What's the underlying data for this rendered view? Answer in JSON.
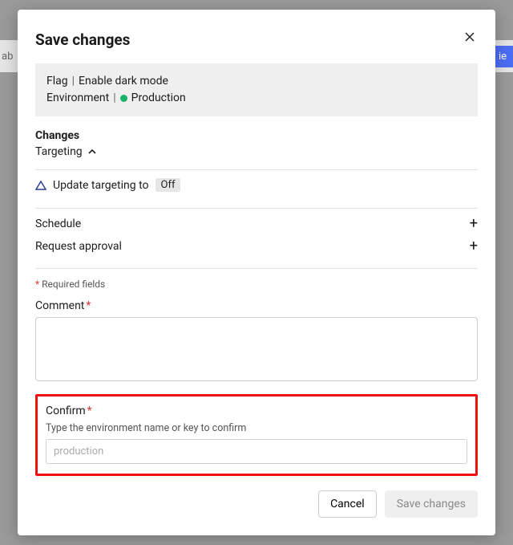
{
  "modal": {
    "title": "Save changes",
    "close_aria": "Close"
  },
  "context": {
    "flag_label": "Flag",
    "flag_name": "Enable dark mode",
    "env_label": "Environment",
    "env_name": "Production",
    "env_dot_color": "#18b36b"
  },
  "changes": {
    "heading": "Changes",
    "group_label": "Targeting",
    "update_prefix": "Update targeting to",
    "update_value": "Off"
  },
  "expandables": {
    "schedule": "Schedule",
    "approval": "Request approval"
  },
  "required_note": "Required fields",
  "comment": {
    "label": "Comment",
    "value": ""
  },
  "confirm": {
    "label": "Confirm",
    "help": "Type the environment name or key to confirm",
    "placeholder": "production",
    "value": ""
  },
  "footer": {
    "cancel": "Cancel",
    "save": "Save changes"
  },
  "background": {
    "left_tab_fragment": "ab",
    "right_pill_fragment": "ie"
  }
}
